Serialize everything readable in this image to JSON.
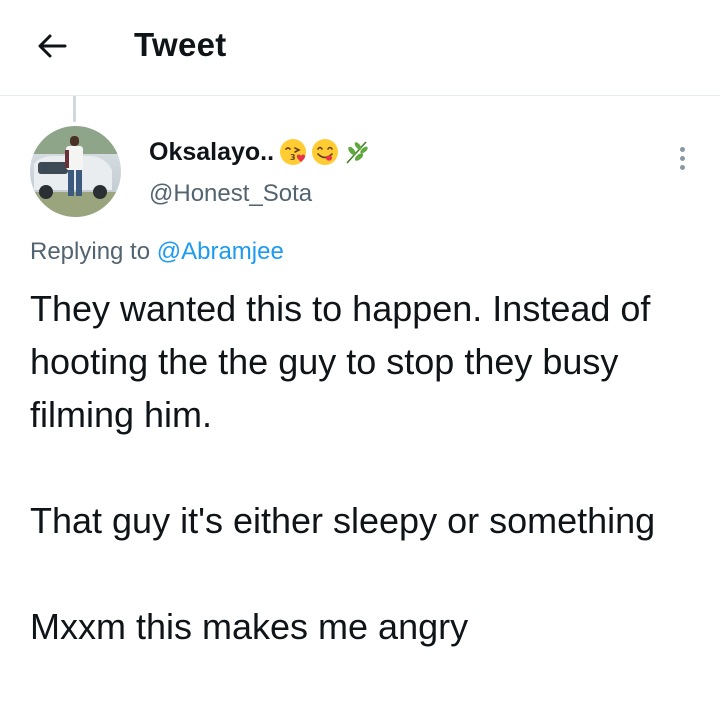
{
  "header": {
    "title": "Tweet",
    "back_icon": "arrow-left-icon"
  },
  "tweet": {
    "author": {
      "display_name": "Oksalayo..",
      "name_emojis": [
        "face-blowing-kiss-emoji",
        "face-savoring-food-emoji",
        "herb-emoji"
      ],
      "handle": "@Honest_Sota"
    },
    "reply": {
      "prefix": "Replying to",
      "to_handle": "@Abramjee"
    },
    "body": {
      "paragraph_1": "They wanted this to happen. Instead of hooting the the guy to stop they busy filming him.",
      "paragraph_2": "That guy it's either sleepy or something",
      "paragraph_3": "Mxxm this makes me angry"
    },
    "more_icon": "more-vertical-icon"
  },
  "colors": {
    "text_primary": "#0f1419",
    "text_secondary": "#536471",
    "link": "#1d9bf0",
    "divider": "#e6ecf0"
  }
}
